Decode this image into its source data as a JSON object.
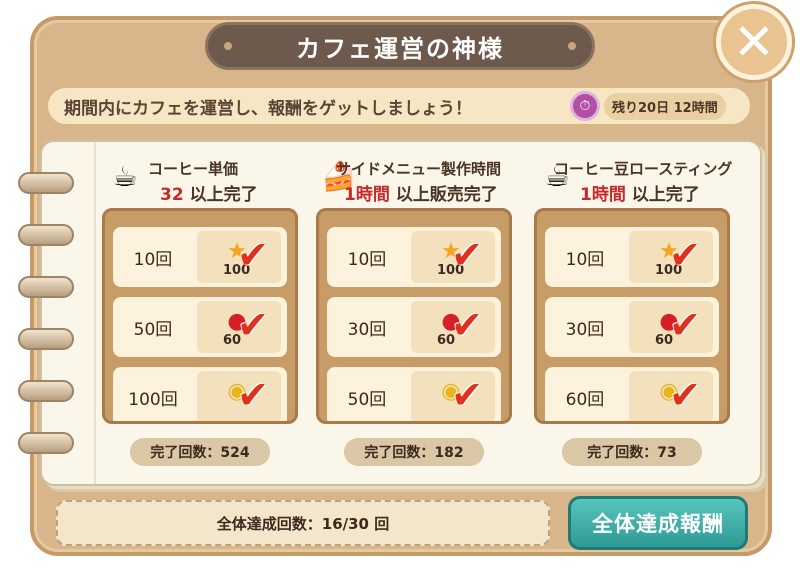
{
  "header": {
    "title": "カフェ運営の神様",
    "close_label": "✕"
  },
  "info": {
    "message": "期間内にカフェを運営し、報酬をゲットしましょう！",
    "timer_text": "残り20日 12時間"
  },
  "columns": [
    {
      "title": "コーヒー単価",
      "sub_highlight": "32",
      "sub_text": " 以上完了",
      "icon": "coffee-cup-icon",
      "rows": [
        {
          "count": "10回",
          "icon": "star-icon",
          "amount": "100"
        },
        {
          "count": "50回",
          "icon": "apple-icon",
          "amount": "60"
        },
        {
          "count": "100回",
          "icon": "gold-coin-icon",
          "amount": ""
        }
      ],
      "done": "完了回数：524"
    },
    {
      "title": "サイドメニュー製作時間",
      "sub_highlight": "1時間",
      "sub_text": " 以上販売完了",
      "icon": "dessert-icon",
      "rows": [
        {
          "count": "10回",
          "icon": "star-icon",
          "amount": "100"
        },
        {
          "count": "30回",
          "icon": "apple-icon",
          "amount": "60"
        },
        {
          "count": "50回",
          "icon": "gold-coin-icon",
          "amount": ""
        }
      ],
      "done": "完了回数：182"
    },
    {
      "title": "コーヒー豆ロースティング",
      "sub_highlight": "1時間",
      "sub_text": " 以上完了",
      "icon": "coffee-beans-icon",
      "rows": [
        {
          "count": "10回",
          "icon": "star-icon",
          "amount": "100"
        },
        {
          "count": "30回",
          "icon": "apple-icon",
          "amount": "60"
        },
        {
          "count": "60回",
          "icon": "gold-coin-icon",
          "amount": ""
        }
      ],
      "done": "完了回数：73"
    }
  ],
  "footer": {
    "total_text": "全体達成回数：16/30 回",
    "total_button": "全体達成報酬"
  },
  "colors": {
    "highlight_red": "#c8282a",
    "button_teal": "#2f9a94",
    "check_red": "#e0301e"
  }
}
